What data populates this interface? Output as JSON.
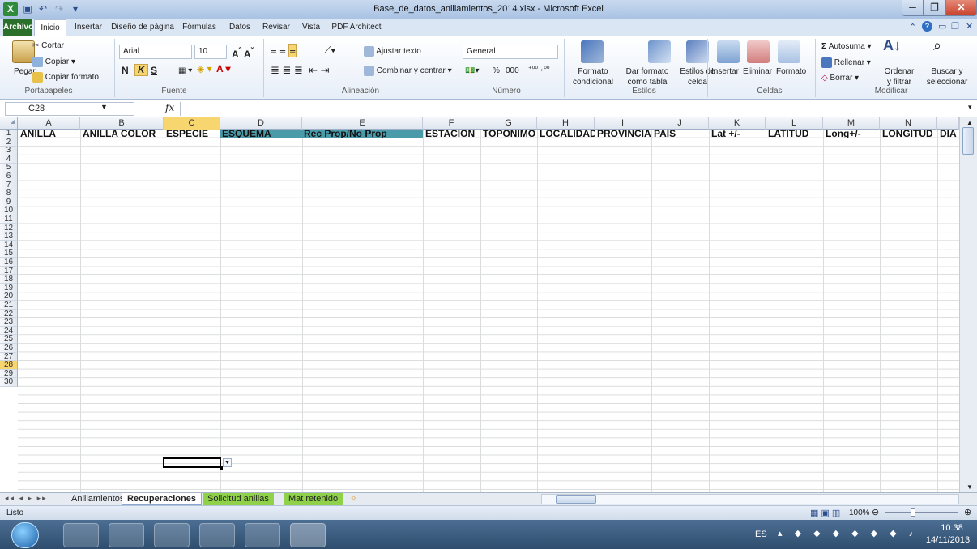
{
  "window": {
    "title": "Base_de_datos_anillamientos_2014.xlsx  -  Microsoft Excel"
  },
  "tabs": [
    "Archivo",
    "Inicio",
    "Insertar",
    "Diseño de página",
    "Fórmulas",
    "Datos",
    "Revisar",
    "Vista",
    "PDF Architect"
  ],
  "ribbon": {
    "portapapeles": {
      "paste": "Pegar",
      "cut": "Cortar",
      "copy": "Copiar",
      "format_painter": "Copiar formato",
      "label": "Portapapeles"
    },
    "fuente": {
      "font": "Arial",
      "size": "10",
      "bold": "N",
      "italic": "K",
      "underline": "S",
      "label": "Fuente"
    },
    "alineacion": {
      "wrap": "Ajustar texto",
      "merge": "Combinar y centrar",
      "label": "Alineación"
    },
    "numero": {
      "format": "General",
      "percent": "%",
      "thousands": "000",
      "label": "Número"
    },
    "estilos": {
      "cond1": "Formato",
      "cond2": "condicional",
      "table1": "Dar formato",
      "table2": "como tabla",
      "cell1": "Estilos de",
      "cell2": "celda",
      "label": "Estilos"
    },
    "celdas": {
      "insert": "Insertar",
      "delete": "Eliminar",
      "format": "Formato",
      "label": "Celdas"
    },
    "modificar": {
      "autosum": "Autosuma",
      "fill": "Rellenar",
      "clear": "Borrar",
      "sort1": "Ordenar",
      "sort2": "y filtrar",
      "find1": "Buscar y",
      "find2": "seleccionar",
      "label": "Modificar"
    }
  },
  "formula_bar": {
    "name_box": "C28",
    "fx": "fx",
    "value": ""
  },
  "columns": [
    "A",
    "B",
    "C",
    "D",
    "E",
    "F",
    "G",
    "H",
    "I",
    "J",
    "K",
    "L",
    "M",
    "N"
  ],
  "headers": [
    "ANILLA",
    "ANILLA COLOR",
    "ESPECIE",
    "ESQUEMA",
    "Rec Prop/No Prop",
    "ESTACION",
    "TOPONIMO",
    "LOCALIDAD",
    "PROVINCIA",
    "PAIS",
    "Lat +/-",
    "LATITUD",
    "Long+/-",
    "LONGITUD",
    "DIA"
  ],
  "rows": [
    "1",
    "2",
    "3",
    "4",
    "5",
    "6",
    "7",
    "8",
    "9",
    "10",
    "11",
    "12",
    "13",
    "14",
    "15",
    "16",
    "17",
    "18",
    "19",
    "20",
    "21",
    "22",
    "23",
    "24",
    "25",
    "26",
    "27",
    "28",
    "29",
    "30"
  ],
  "sheets": [
    "Anillamientos",
    "Recuperaciones",
    "Solicitud anillas",
    "Mat retenido"
  ],
  "active_sheet": "Recuperaciones",
  "status": {
    "ready": "Listo",
    "zoom": "100%"
  },
  "taskbar": {
    "lang": "ES",
    "time": "10:38",
    "date": "14/11/2013"
  },
  "colors": {
    "selected_header": "#f7d56f",
    "teal_header": "#4a9ba9",
    "green_tab": "#8fd24a",
    "file_tab": "#2a6f2a"
  }
}
